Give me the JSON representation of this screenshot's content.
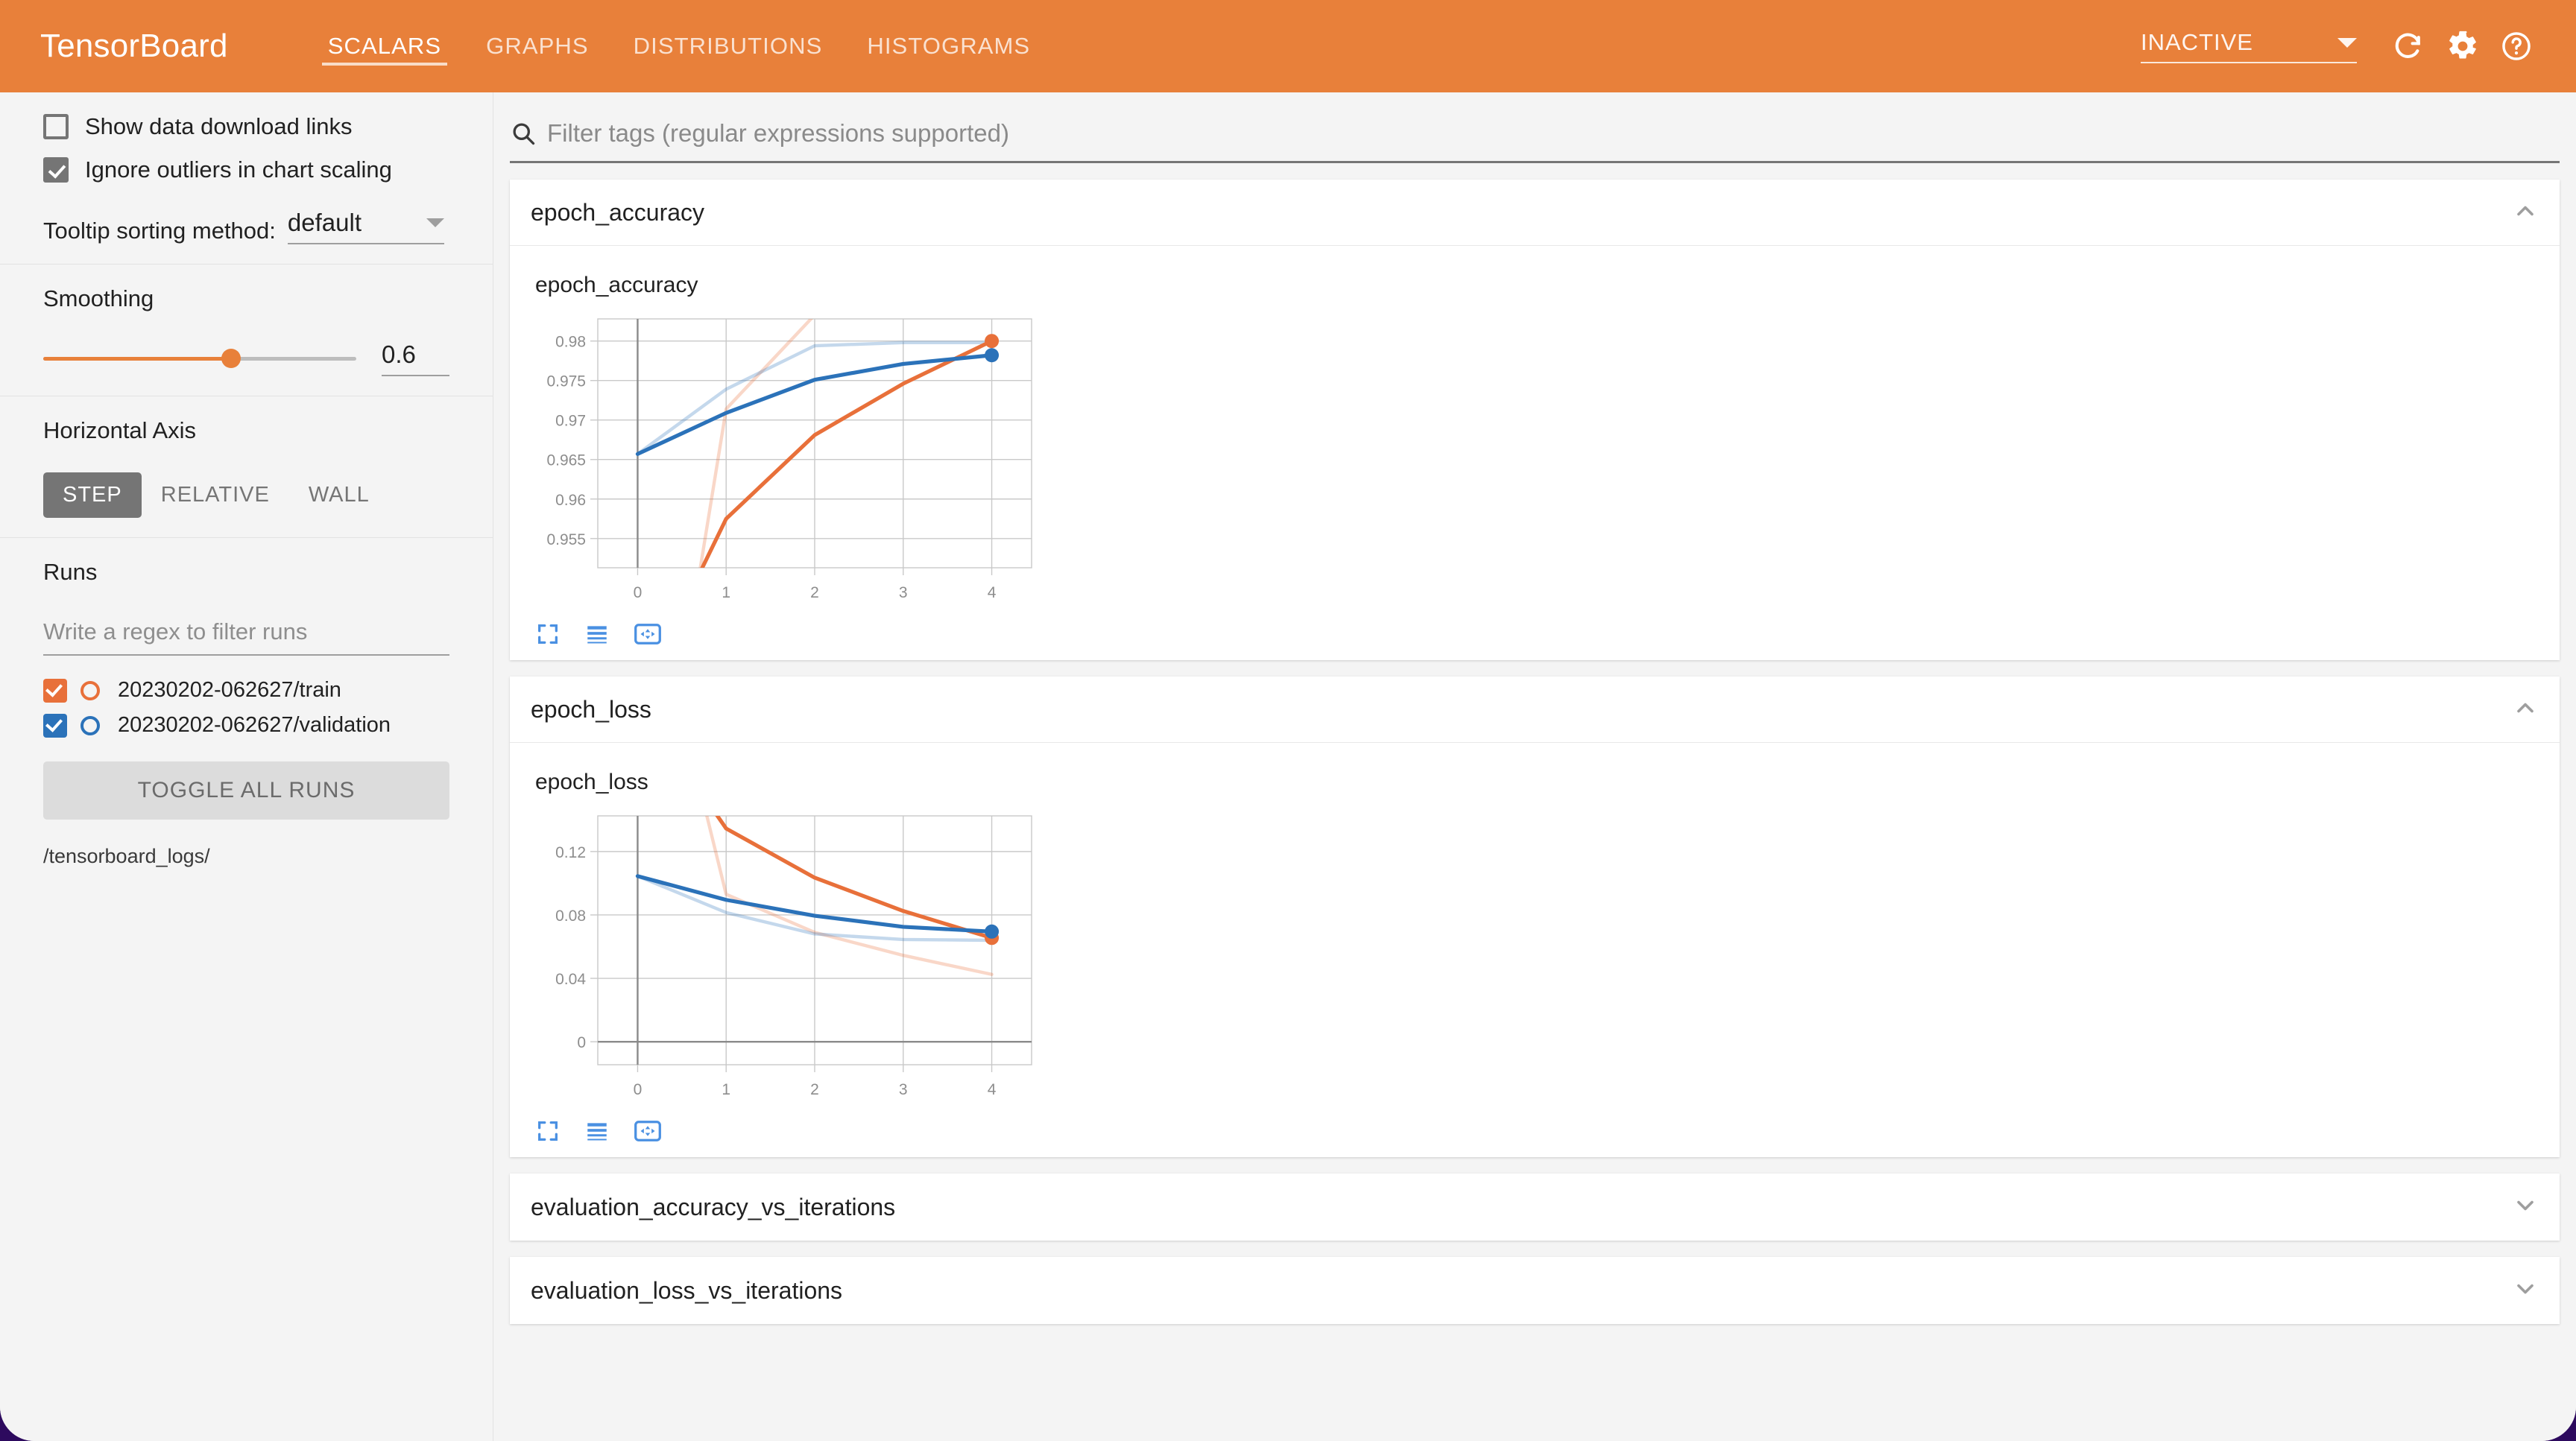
{
  "header": {
    "brand": "TensorBoard",
    "tabs": [
      {
        "label": "SCALARS",
        "active": true
      },
      {
        "label": "GRAPHS",
        "active": false
      },
      {
        "label": "DISTRIBUTIONS",
        "active": false
      },
      {
        "label": "HISTOGRAMS",
        "active": false
      }
    ],
    "status": "INACTIVE",
    "reload_icon": "refresh-icon",
    "settings_icon": "gear-icon",
    "help_icon": "help-icon"
  },
  "sidebar": {
    "checkboxes": [
      {
        "label": "Show data download links",
        "checked": false
      },
      {
        "label": "Ignore outliers in chart scaling",
        "checked": true
      }
    ],
    "tooltip_sorting": {
      "label": "Tooltip sorting method:",
      "value": "default"
    },
    "smoothing": {
      "title": "Smoothing",
      "value": "0.6",
      "fraction": 0.6
    },
    "horizontal_axis": {
      "title": "Horizontal Axis",
      "options": [
        {
          "label": "STEP",
          "active": true
        },
        {
          "label": "RELATIVE",
          "active": false
        },
        {
          "label": "WALL",
          "active": false
        }
      ]
    },
    "runs": {
      "title": "Runs",
      "filter_placeholder": "Write a regex to filter runs",
      "filter_value": "",
      "items": [
        {
          "name": "20230202-062627/train",
          "color": "#e8703a",
          "checked": true
        },
        {
          "name": "20230202-062627/validation",
          "color": "#2b72b9",
          "checked": true
        }
      ],
      "toggle_all_label": "TOGGLE ALL RUNS",
      "logdir": "/tensorboard_logs/"
    }
  },
  "main": {
    "filter": {
      "placeholder": "Filter tags (regular expressions supported)",
      "value": "",
      "icon": "search-icon"
    },
    "cards": [
      {
        "title": "epoch_accuracy",
        "expanded": true,
        "chevron": "chevron-up-icon"
      },
      {
        "title": "epoch_loss",
        "expanded": true,
        "chevron": "chevron-up-icon"
      },
      {
        "title": "evaluation_accuracy_vs_iterations",
        "expanded": false,
        "chevron": "chevron-down-icon"
      },
      {
        "title": "evaluation_loss_vs_iterations",
        "expanded": false,
        "chevron": "chevron-down-icon"
      }
    ],
    "chart_controls": [
      {
        "name": "expand-chart-icon"
      },
      {
        "name": "toggle-axis-scale-icon"
      },
      {
        "name": "pan-reset-icon"
      }
    ]
  },
  "chart_data": [
    {
      "type": "line",
      "title": "epoch_accuracy",
      "xlabel": "",
      "ylabel": "",
      "x": [
        0,
        1,
        2,
        3,
        4
      ],
      "xticks": [
        "0",
        "1",
        "2",
        "3",
        "4"
      ],
      "yticks": [
        "0.955",
        "0.96",
        "0.965",
        "0.97",
        "0.975",
        "0.98"
      ],
      "xlim": [
        -0.45,
        4.45
      ],
      "ylim": [
        0.9513,
        0.9828
      ],
      "grid": true,
      "legend": "none",
      "series": [
        {
          "name": "20230202-062627/train (smoothed)",
          "color": "#e8703a",
          "opacity": 1.0,
          "values": [
            0.9345,
            0.9575,
            0.9681,
            0.9746,
            0.98
          ],
          "endpoint_marker": true
        },
        {
          "name": "20230202-062627/train (raw)",
          "color": "#e8703a",
          "opacity": 0.28,
          "values": [
            0.9025,
            0.9714,
            0.9833,
            0.9876,
            0.9904
          ],
          "endpoint_marker": false
        },
        {
          "name": "20230202-062627/validation (smoothed)",
          "color": "#2b72b9",
          "opacity": 1.0,
          "values": [
            0.9657,
            0.9709,
            0.9751,
            0.9771,
            0.9782
          ],
          "endpoint_marker": true
        },
        {
          "name": "20230202-062627/validation (raw)",
          "color": "#2b72b9",
          "opacity": 0.28,
          "values": [
            0.9657,
            0.9739,
            0.9794,
            0.9798,
            0.9798
          ],
          "endpoint_marker": false
        }
      ]
    },
    {
      "type": "line",
      "title": "epoch_loss",
      "xlabel": "",
      "ylabel": "",
      "x": [
        0,
        1,
        2,
        3,
        4
      ],
      "xticks": [
        "0",
        "1",
        "2",
        "3",
        "4"
      ],
      "yticks": [
        "0",
        "0.04",
        "0.08",
        "0.12"
      ],
      "xlim": [
        -0.45,
        4.45
      ],
      "ylim": [
        -0.0145,
        0.1425
      ],
      "grid": true,
      "legend": "none",
      "series": [
        {
          "name": "20230202-062627/train (smoothed)",
          "color": "#e8703a",
          "opacity": 1.0,
          "values": [
            0.2155,
            0.1345,
            0.1035,
            0.0825,
            0.0655
          ],
          "endpoint_marker": true
        },
        {
          "name": "20230202-062627/train (raw)",
          "color": "#e8703a",
          "opacity": 0.28,
          "values": [
            0.32,
            0.093,
            0.069,
            0.0545,
            0.0425
          ],
          "endpoint_marker": false
        },
        {
          "name": "20230202-062627/validation (smoothed)",
          "color": "#2b72b9",
          "opacity": 1.0,
          "values": [
            0.1045,
            0.0895,
            0.0795,
            0.0725,
            0.0695
          ],
          "endpoint_marker": true
        },
        {
          "name": "20230202-062627/validation (raw)",
          "color": "#2b72b9",
          "opacity": 0.28,
          "values": [
            0.1045,
            0.0815,
            0.068,
            0.0645,
            0.064
          ],
          "endpoint_marker": false
        }
      ]
    }
  ]
}
